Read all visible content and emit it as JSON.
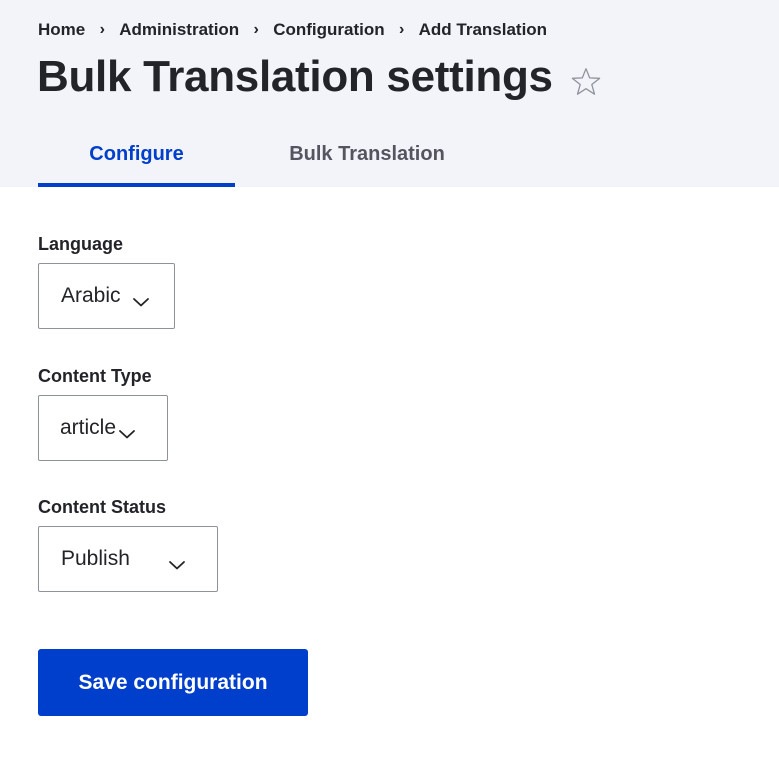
{
  "breadcrumb": {
    "items": [
      "Home",
      "Administration",
      "Configuration",
      "Add Translation"
    ],
    "separator": "›"
  },
  "page": {
    "title": "Bulk Translation settings",
    "favorite_icon": "star-outline-icon"
  },
  "tabs": [
    {
      "label": "Configure",
      "active": true
    },
    {
      "label": "Bulk Translation",
      "active": false
    }
  ],
  "form": {
    "language": {
      "label": "Language",
      "value": "Arabic"
    },
    "content_type": {
      "label": "Content Type",
      "value": "article"
    },
    "content_status": {
      "label": "Content Status",
      "value": "Publish"
    },
    "submit_label": "Save configuration"
  },
  "colors": {
    "accent": "#003ecc",
    "header_bg": "#f3f4f9",
    "text": "#232429"
  }
}
